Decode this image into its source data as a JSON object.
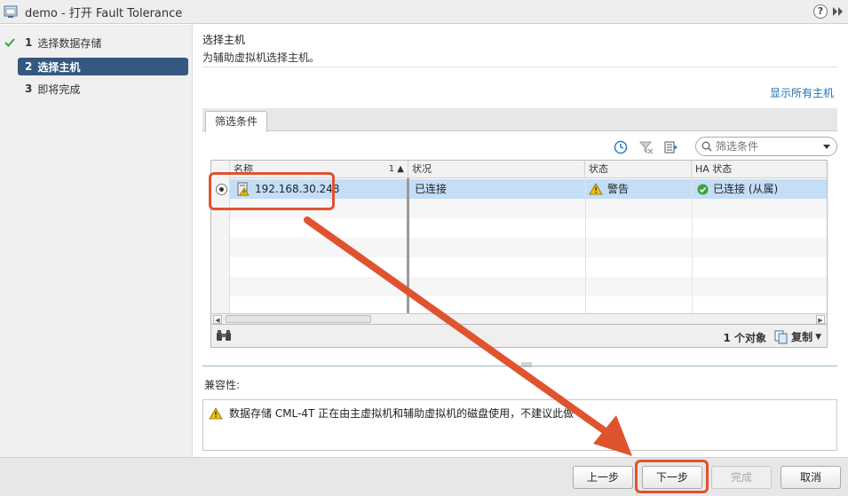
{
  "window": {
    "title": "demo - 打开 Fault Tolerance",
    "help_glyph": "?"
  },
  "sidebar": {
    "steps": [
      {
        "num": "1",
        "label": "选择数据存储",
        "state": "done"
      },
      {
        "num": "2",
        "label": "选择主机",
        "state": "active"
      },
      {
        "num": "3",
        "label": "即将完成",
        "state": "pending"
      }
    ]
  },
  "main": {
    "title": "选择主机",
    "subtitle": "为辅助虚拟机选择主机。",
    "show_all_link": "显示所有主机",
    "tab_label": "筛选条件",
    "filter_placeholder": "筛选条件"
  },
  "table": {
    "columns": [
      {
        "label": "名称",
        "sort": "1 ▲"
      },
      {
        "label": "状况"
      },
      {
        "label": "状态"
      },
      {
        "label": "HA 状态"
      }
    ],
    "rows": [
      {
        "name": "192.168.30.248",
        "condition": "已连接",
        "status": "警告",
        "ha_status": "已连接 (从属)",
        "selected": true
      }
    ],
    "object_count": "1 个对象",
    "copy_label": "复制"
  },
  "compatibility": {
    "label": "兼容性:",
    "message": "数据存储 CML-4T 正在由主虚拟机和辅助虚拟机的磁盘使用，不建议此做"
  },
  "buttons": {
    "back": "上一步",
    "next": "下一步",
    "finish": "完成",
    "cancel": "取消"
  },
  "colors": {
    "accent": "#34587f",
    "highlight": "#e0532f",
    "link": "#1f6fb2",
    "row_selected": "#c4def7",
    "ok": "#3aa53a",
    "warning": "#f2c200"
  }
}
